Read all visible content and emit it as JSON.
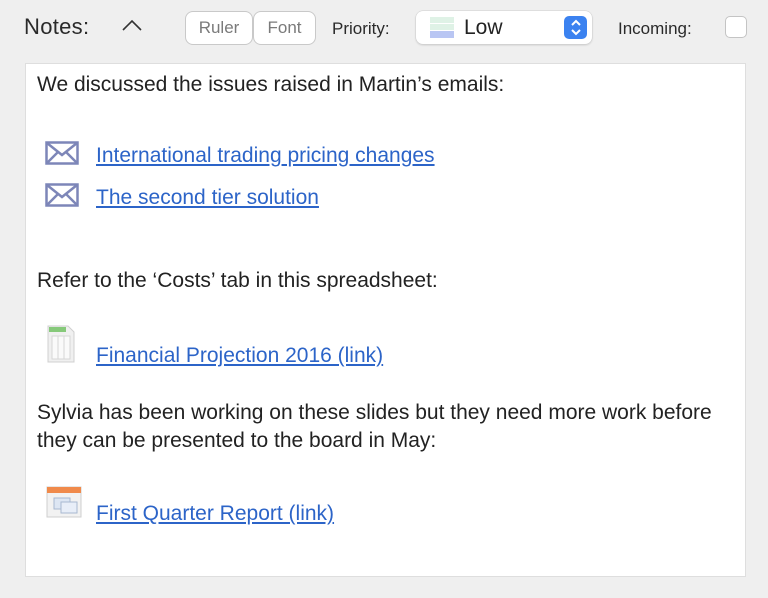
{
  "header": {
    "title": "Notes:",
    "collapse_icon": "chevron-up-icon",
    "ruler_label": "Ruler",
    "font_label": "Font",
    "priority_label": "Priority:",
    "priority_value": "Low",
    "priority_swatch_colors": [
      "#dff2e6",
      "#dff2e6",
      "#b9c6f3"
    ],
    "stepper_color": "#3b82f0",
    "incoming_label": "Incoming:",
    "incoming_checked": false
  },
  "notes": {
    "intro": "We discussed the issues raised in Martin’s emails:",
    "email_links": [
      {
        "icon": "envelope-icon",
        "label": "International trading pricing changes"
      },
      {
        "icon": "envelope-icon",
        "label": "The second tier solution"
      }
    ],
    "costs_text": "Refer to the ‘Costs’ tab in this spreadsheet:",
    "spreadsheet_link": {
      "icon": "spreadsheet-file-icon",
      "label": "Financial Projection 2016 (link)"
    },
    "slides_text": "Sylvia has been working on these slides but they need more work before they can be presented to the board in May:",
    "presentation_link": {
      "icon": "presentation-file-icon",
      "label": "First Quarter Report (link)"
    }
  },
  "colors": {
    "link": "#2c64c8",
    "envelope": "#7d86b8"
  }
}
